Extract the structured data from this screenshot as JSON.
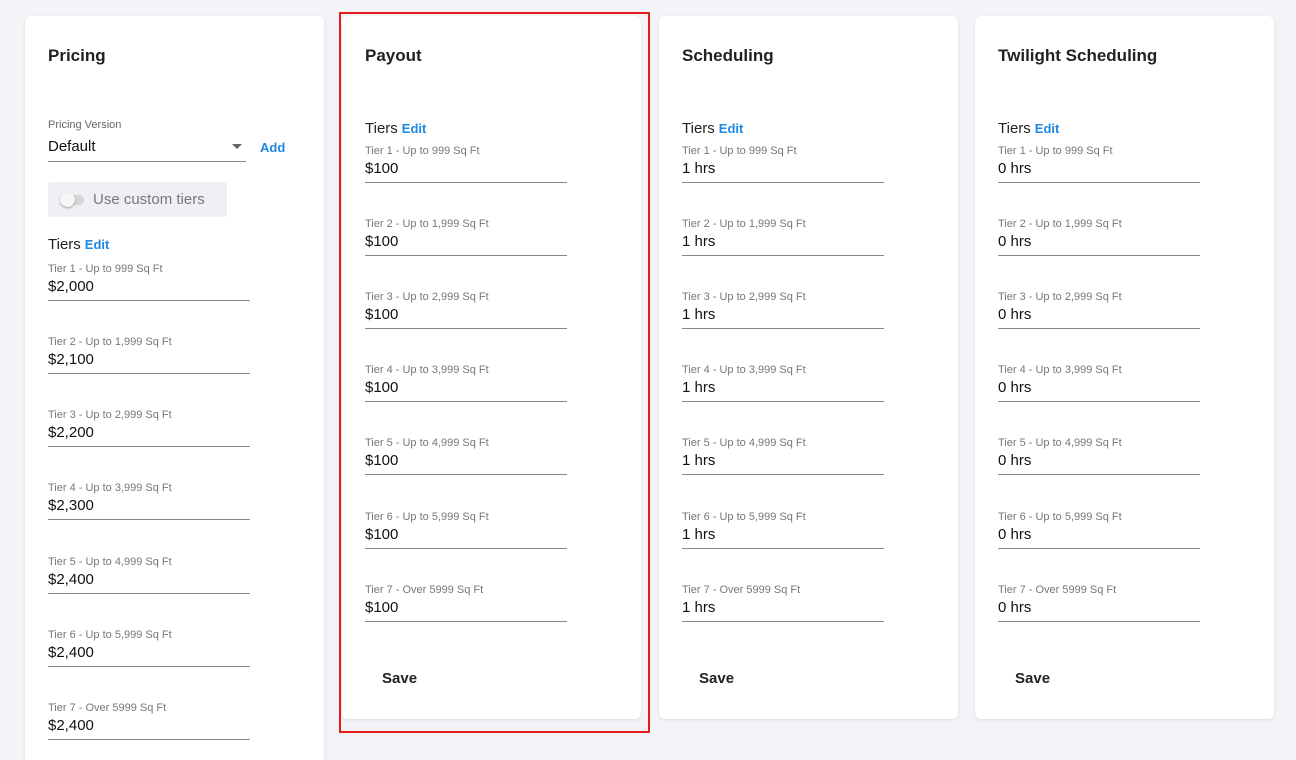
{
  "pricing": {
    "title": "Pricing",
    "version_label": "Pricing Version",
    "version_value": "Default",
    "add_label": "Add",
    "toggle_label": "Use custom tiers",
    "tiers_label": "Tiers",
    "edit_label": "Edit",
    "tiers": [
      {
        "label": "Tier 1 - Up to 999 Sq Ft",
        "value": "$2,000"
      },
      {
        "label": "Tier 2 - Up to 1,999 Sq Ft",
        "value": "$2,100"
      },
      {
        "label": "Tier 3 - Up to 2,999 Sq Ft",
        "value": "$2,200"
      },
      {
        "label": "Tier 4 - Up to 3,999 Sq Ft",
        "value": "$2,300"
      },
      {
        "label": "Tier 5 - Up to 4,999 Sq Ft",
        "value": "$2,400"
      },
      {
        "label": "Tier 6 - Up to 5,999 Sq Ft",
        "value": "$2,400"
      },
      {
        "label": "Tier 7 - Over 5999 Sq Ft",
        "value": "$2,400"
      }
    ]
  },
  "payout": {
    "title": "Payout",
    "tiers_label": "Tiers",
    "edit_label": "Edit",
    "save_label": "Save",
    "tiers": [
      {
        "label": "Tier 1 - Up to 999 Sq Ft",
        "value": "$100"
      },
      {
        "label": "Tier 2 - Up to 1,999 Sq Ft",
        "value": "$100"
      },
      {
        "label": "Tier 3 - Up to 2,999 Sq Ft",
        "value": "$100"
      },
      {
        "label": "Tier 4 - Up to 3,999 Sq Ft",
        "value": "$100"
      },
      {
        "label": "Tier 5 - Up to 4,999 Sq Ft",
        "value": "$100"
      },
      {
        "label": "Tier 6 - Up to 5,999 Sq Ft",
        "value": "$100"
      },
      {
        "label": "Tier 7 - Over 5999 Sq Ft",
        "value": "$100"
      }
    ]
  },
  "scheduling": {
    "title": "Scheduling",
    "tiers_label": "Tiers",
    "edit_label": "Edit",
    "save_label": "Save",
    "tiers": [
      {
        "label": "Tier 1 - Up to 999 Sq Ft",
        "value": "1 hrs"
      },
      {
        "label": "Tier 2 - Up to 1,999 Sq Ft",
        "value": "1 hrs"
      },
      {
        "label": "Tier 3 - Up to 2,999 Sq Ft",
        "value": "1 hrs"
      },
      {
        "label": "Tier 4 - Up to 3,999 Sq Ft",
        "value": "1 hrs"
      },
      {
        "label": "Tier 5 - Up to 4,999 Sq Ft",
        "value": "1 hrs"
      },
      {
        "label": "Tier 6 - Up to 5,999 Sq Ft",
        "value": "1 hrs"
      },
      {
        "label": "Tier 7 - Over 5999 Sq Ft",
        "value": "1 hrs"
      }
    ]
  },
  "twilight": {
    "title": "Twilight Scheduling",
    "tiers_label": "Tiers",
    "edit_label": "Edit",
    "save_label": "Save",
    "tiers": [
      {
        "label": "Tier 1 - Up to 999 Sq Ft",
        "value": "0 hrs"
      },
      {
        "label": "Tier 2 - Up to 1,999 Sq Ft",
        "value": "0 hrs"
      },
      {
        "label": "Tier 3 - Up to 2,999 Sq Ft",
        "value": "0 hrs"
      },
      {
        "label": "Tier 4 - Up to 3,999 Sq Ft",
        "value": "0 hrs"
      },
      {
        "label": "Tier 5 - Up to 4,999 Sq Ft",
        "value": "0 hrs"
      },
      {
        "label": "Tier 6 - Up to 5,999 Sq Ft",
        "value": "0 hrs"
      },
      {
        "label": "Tier 7 - Over 5999 Sq Ft",
        "value": "0 hrs"
      }
    ]
  },
  "colors": {
    "link": "#1e88e5",
    "highlight": "#e51c1c",
    "background": "#f3f4f8"
  }
}
